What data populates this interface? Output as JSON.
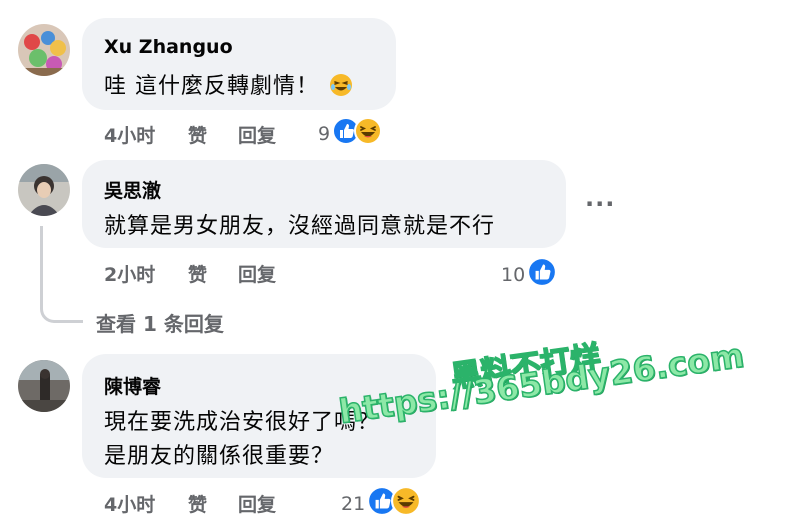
{
  "comments": [
    {
      "author": "Xu Zhanguo",
      "text": "哇 這什麼反轉劇情！",
      "emoji_icon": "laughing-tears-emoji-icon",
      "time": "4小时",
      "like_label": "赞",
      "reply_label": "回复",
      "reaction_count": "9",
      "reaction_icons": [
        "like-reaction-icon",
        "haha-reaction-icon"
      ]
    },
    {
      "author": "吳思澈",
      "text": "就算是男女朋友，沒經過同意就是不行",
      "time": "2小时",
      "like_label": "赞",
      "reply_label": "回复",
      "reaction_count": "10",
      "reaction_icons": [
        "like-reaction-icon"
      ],
      "more_label": "···",
      "view_replies": "查看 1 条回复"
    },
    {
      "author": "陳博睿",
      "text_lines": [
        "現在要洗成治安很好了嗎？",
        "是朋友的關係很重要？"
      ],
      "time": "4小时",
      "like_label": "赞",
      "reply_label": "回复",
      "reaction_count": "21",
      "reaction_icons": [
        "like-reaction-icon",
        "haha-reaction-icon"
      ]
    }
  ],
  "watermark": {
    "line1": "黑料不打烊",
    "line2": "https://365bdy26.com"
  },
  "colors": {
    "bubble": "#f0f2f5",
    "secondary_text": "#65676b",
    "like_blue": "#1877f2",
    "haha_yellow": "#f7b928",
    "watermark_green": "#8de8a7"
  }
}
